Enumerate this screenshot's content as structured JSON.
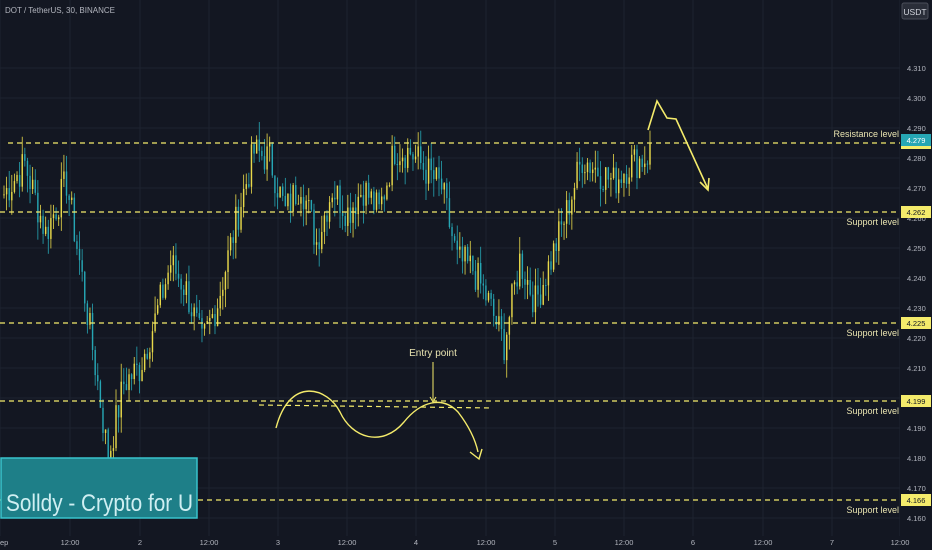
{
  "header": {
    "symbol_line": "DOT / TetherUS, 30, BINANCE",
    "currency": "USDT"
  },
  "watermark": {
    "text": "Solldy - Crypto for U"
  },
  "colors": {
    "background": "#131722",
    "grid": "#1e2330",
    "up": "#e8d94a",
    "down": "#26a6b4",
    "level_line": "#f4eb6b",
    "axis_text": "#b2b5be",
    "watermark_bg": "#1e7f88",
    "watermark_border": "#39c4cc"
  },
  "chart_data": {
    "type": "candlestick",
    "title": "DOT / TetherUS, 30, BINANCE",
    "ylim": [
      4.16,
      4.32
    ],
    "y_ticks": [
      4.31,
      4.3,
      4.29,
      4.28,
      4.27,
      4.26,
      4.25,
      4.24,
      4.23,
      4.22,
      4.21,
      4.2,
      4.19,
      4.18,
      4.17,
      4.16
    ],
    "y_tick_labels": [
      "4.310",
      "4.300",
      "4.290",
      "4.280",
      "4.270",
      "4.260",
      "4.250",
      "4.240",
      "4.230",
      "4.220",
      "4.210",
      "4.200",
      "4.190",
      "4.180",
      "4.170",
      "4.160"
    ],
    "x_tick_labels": [
      "ep",
      "12:00",
      "2",
      "12:00",
      "3",
      "12:00",
      "4",
      "12:00",
      "5",
      "12:00",
      "6",
      "12:00",
      "7",
      "12:00"
    ],
    "levels": [
      {
        "name": "Resistance level",
        "price": 4.285,
        "label": "4.285"
      },
      {
        "name": "Support level",
        "price": 4.262,
        "label": "4.262"
      },
      {
        "name": "Support level",
        "price": 4.225,
        "label": "4.225"
      },
      {
        "name": "Support level",
        "price": 4.199,
        "label": "4.199"
      },
      {
        "name": "Support level",
        "price": 4.166,
        "label": "4.166"
      }
    ],
    "current_price_label": "4.279",
    "annotations": [
      {
        "text": "Entry point"
      }
    ],
    "anchors": [
      [
        0,
        4.268
      ],
      [
        8,
        4.278
      ],
      [
        16,
        4.255
      ],
      [
        24,
        4.272
      ],
      [
        30,
        4.24
      ],
      [
        36,
        4.205
      ],
      [
        40,
        4.18
      ],
      [
        46,
        4.205
      ],
      [
        52,
        4.21
      ],
      [
        58,
        4.226
      ],
      [
        64,
        4.245
      ],
      [
        70,
        4.236
      ],
      [
        76,
        4.218
      ],
      [
        82,
        4.232
      ],
      [
        90,
        4.262
      ],
      [
        96,
        4.282
      ],
      [
        102,
        4.28
      ],
      [
        108,
        4.262
      ],
      [
        114,
        4.272
      ],
      [
        120,
        4.252
      ],
      [
        126,
        4.27
      ],
      [
        132,
        4.262
      ],
      [
        138,
        4.27
      ],
      [
        144,
        4.262
      ],
      [
        150,
        4.283
      ],
      [
        156,
        4.282
      ],
      [
        162,
        4.276
      ],
      [
        168,
        4.27
      ],
      [
        174,
        4.246
      ],
      [
        180,
        4.243
      ],
      [
        186,
        4.232
      ],
      [
        192,
        4.218
      ],
      [
        198,
        4.246
      ],
      [
        204,
        4.232
      ],
      [
        210,
        4.246
      ],
      [
        216,
        4.262
      ],
      [
        222,
        4.28
      ],
      [
        228,
        4.276
      ],
      [
        234,
        4.272
      ],
      [
        240,
        4.278
      ],
      [
        246,
        4.28
      ],
      [
        248,
        4.282
      ]
    ]
  }
}
